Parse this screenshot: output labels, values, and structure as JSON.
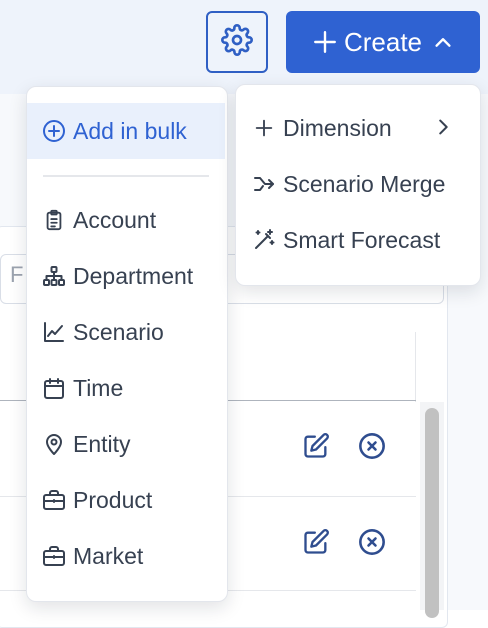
{
  "header": {
    "settings_icon": "gear-icon",
    "create_button": {
      "label": "Create",
      "icon_left": "plus-icon",
      "icon_right": "chevron-up-icon",
      "color": "#2f62d2"
    }
  },
  "background": {
    "filter_placeholder": "F"
  },
  "dimension_menu": {
    "bulk": {
      "label": "Add in bulk",
      "icon": "plus-circle-icon"
    },
    "items": [
      {
        "label": "Account",
        "icon": "clipboard-icon"
      },
      {
        "label": "Department",
        "icon": "org-chart-icon"
      },
      {
        "label": "Scenario",
        "icon": "line-chart-icon"
      },
      {
        "label": "Time",
        "icon": "calendar-icon"
      },
      {
        "label": "Entity",
        "icon": "location-pin-icon"
      },
      {
        "label": "Product",
        "icon": "briefcase-icon"
      },
      {
        "label": "Market",
        "icon": "briefcase-icon"
      }
    ]
  },
  "create_menu": {
    "items": [
      {
        "label": "Dimension",
        "icon": "plus-icon",
        "trailing_icon": "chevron-right-icon"
      },
      {
        "label": "Scenario Merge",
        "icon": "merge-arrow-icon"
      },
      {
        "label": "Smart Forecast",
        "icon": "magic-wand-icon"
      }
    ]
  },
  "table_rows": [
    {
      "edit_icon": "edit-icon",
      "delete_icon": "close-circle-icon"
    },
    {
      "edit_icon": "edit-icon",
      "delete_icon": "close-circle-icon"
    }
  ],
  "colors": {
    "accent": "#2f62d2",
    "icon_blue": "#2f4d8f",
    "text": "#374151"
  }
}
